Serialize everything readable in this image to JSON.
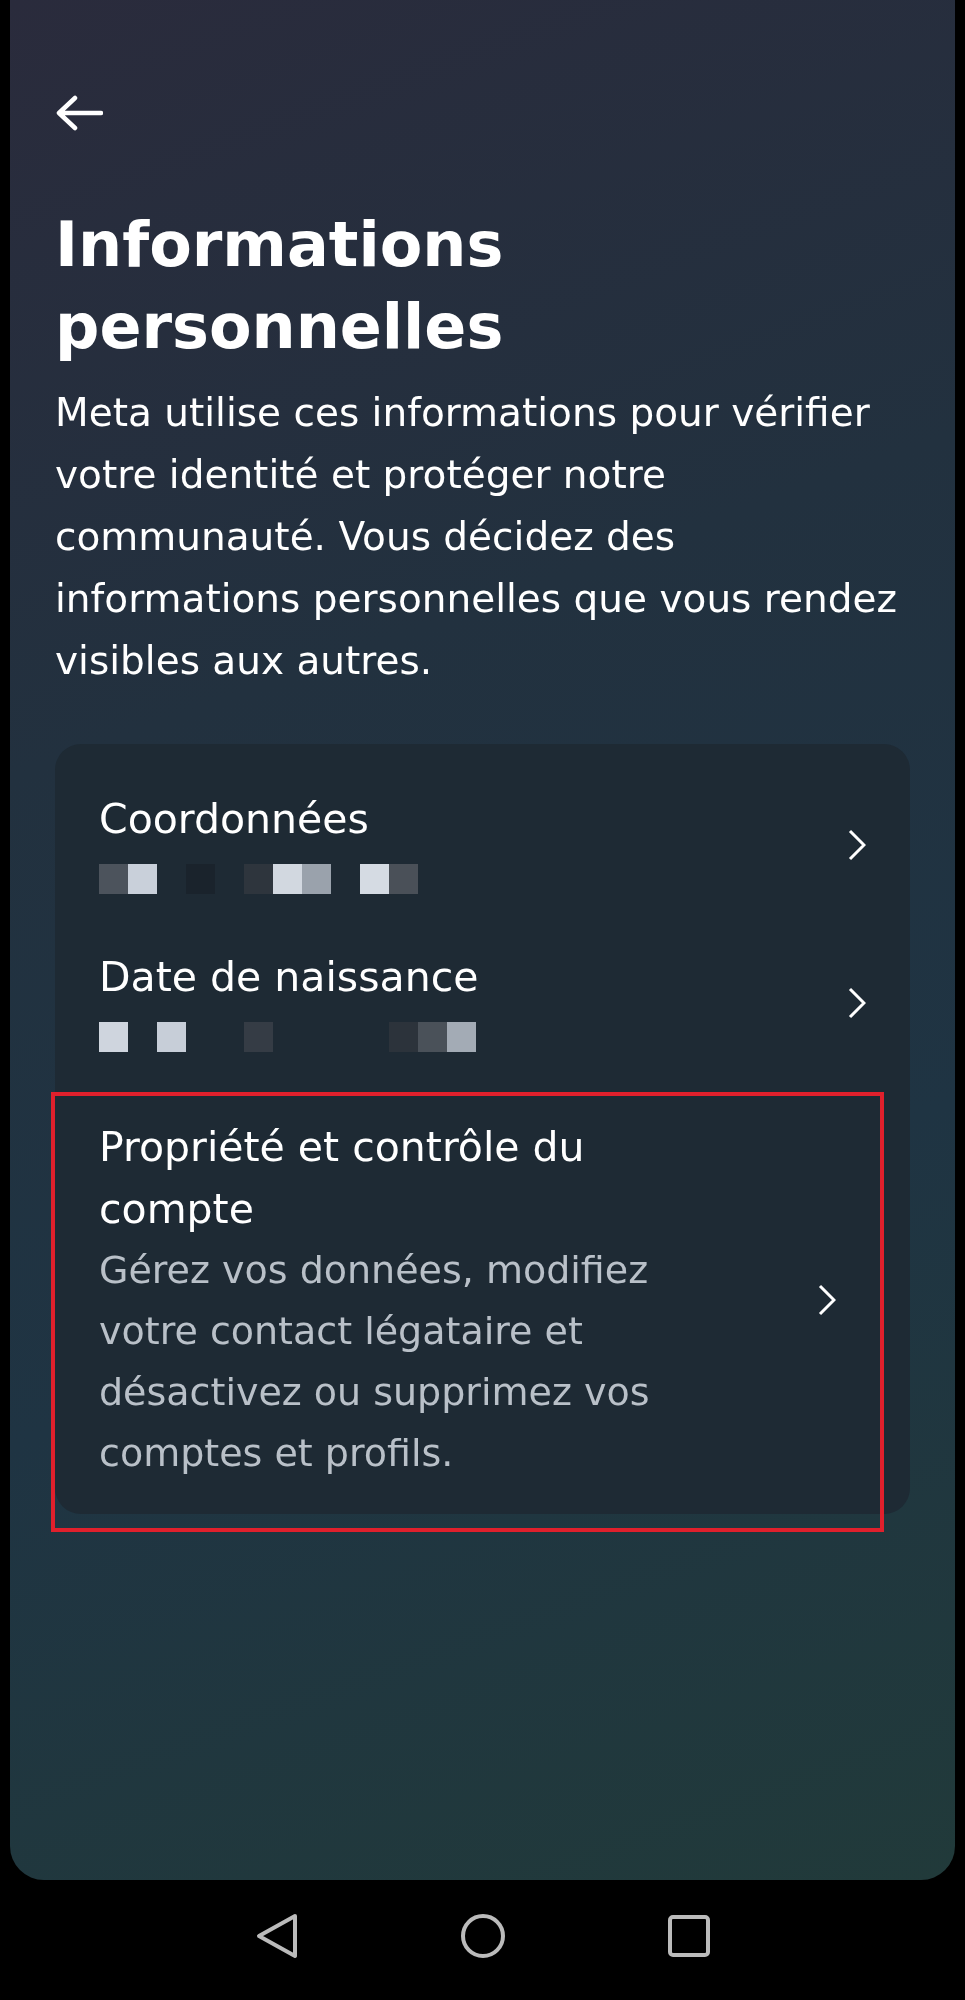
{
  "header": {
    "title": "Informations personnelles",
    "description": "Meta utilise ces informations pour vérifier votre identité et protéger notre communauté. Vous décidez des informations personnelles que vous rendez visibles aux autres."
  },
  "items": [
    {
      "title": "Coordonnées",
      "kind": "redacted",
      "highlighted": false
    },
    {
      "title": "Date de naissance",
      "kind": "redacted",
      "highlighted": false
    },
    {
      "title": "Propriété et contrôle du compte",
      "kind": "text",
      "subtitle": "Gérez vos données, modifiez votre contact légataire et désactivez ou supprimez vos comptes et profils.",
      "highlighted": true
    }
  ],
  "nav_bar": [
    {
      "kind": "back"
    },
    {
      "kind": "home"
    },
    {
      "kind": "recents"
    }
  ]
}
